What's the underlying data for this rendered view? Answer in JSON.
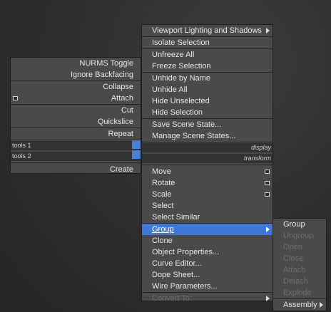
{
  "left_menu": {
    "top_items": [
      {
        "label": "NURMS Toggle"
      },
      {
        "label": "Ignore Backfacing"
      }
    ],
    "mid_items": [
      {
        "label": "Collapse"
      },
      {
        "label": "Attach",
        "has_box": true
      }
    ],
    "edit_items": [
      {
        "label": "Cut"
      },
      {
        "label": "Quickslice"
      }
    ],
    "repeat_item": {
      "label": "Repeat"
    },
    "quad_bars": [
      {
        "left": "tools 1",
        "right": "display"
      },
      {
        "left": "tools 2",
        "right": "transform"
      }
    ],
    "create_item": {
      "label": "Create"
    }
  },
  "quad_colors": {
    "center": "#4a7fd8",
    "highlight": "#3f78d6"
  },
  "right_menu": {
    "display_items": [
      {
        "label": "Viewport Lighting and Shadows",
        "submenu": true
      },
      {
        "label": "Isolate Selection"
      },
      {
        "label": "Unfreeze All"
      },
      {
        "label": "Freeze Selection"
      },
      {
        "label": "Unhide by Name"
      },
      {
        "label": "Unhide All"
      },
      {
        "label": "Hide Unselected"
      },
      {
        "label": "Hide Selection"
      },
      {
        "label": "Save Scene State..."
      },
      {
        "label": "Manage Scene States..."
      }
    ],
    "transform_items": [
      {
        "label": "Move",
        "has_box": true
      },
      {
        "label": "Rotate",
        "has_box": true
      },
      {
        "label": "Scale",
        "has_box": true
      },
      {
        "label": "Select"
      },
      {
        "label": "Select Similar"
      },
      {
        "label": "Group",
        "submenu": true,
        "highlighted": true
      },
      {
        "label": "Clone"
      },
      {
        "label": "Object Properties..."
      },
      {
        "label": "Curve Editor..."
      },
      {
        "label": "Dope Sheet..."
      },
      {
        "label": "Wire Parameters..."
      },
      {
        "label": "Convert To:",
        "submenu": true,
        "disabled": true
      }
    ]
  },
  "group_submenu": {
    "items": [
      {
        "label": "Group",
        "disabled": false
      },
      {
        "label": "Ungroup",
        "disabled": true
      },
      {
        "label": "Open",
        "disabled": true
      },
      {
        "label": "Close",
        "disabled": true
      },
      {
        "label": "Attach",
        "disabled": true
      },
      {
        "label": "Detach",
        "disabled": true
      },
      {
        "label": "Explode",
        "disabled": true
      },
      {
        "label": "Assembly",
        "disabled": false,
        "submenu": true
      }
    ]
  }
}
